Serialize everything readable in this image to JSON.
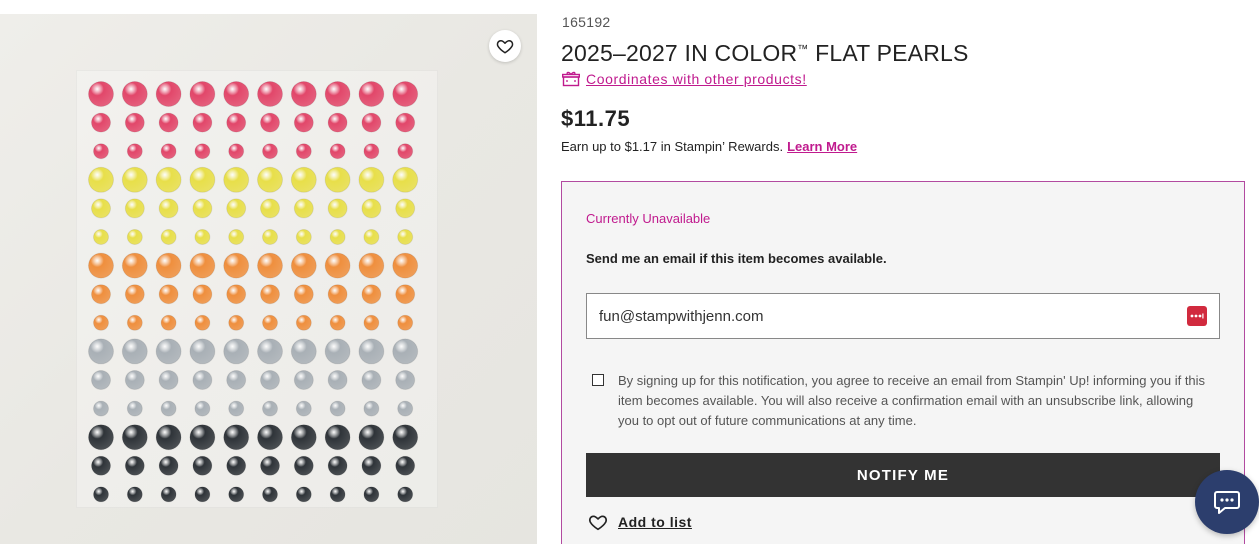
{
  "product": {
    "sku": "165192",
    "title": "2025–2027 IN COLOR",
    "title_tm": "™",
    "title_suffix": " FLAT PEARLS",
    "coordinates_link": "Coordinates with other products!",
    "price": "$11.75",
    "rewards_text": "Earn up to $1.17 in Stampin’ Rewards.",
    "rewards_link": "Learn More"
  },
  "image": {
    "favorite_icon": "heart-outline-icon",
    "pearl_rows": [
      {
        "color": "#e2476a",
        "size": "large"
      },
      {
        "color": "#e2476a",
        "size": "medium"
      },
      {
        "color": "#e2476a",
        "size": "small"
      },
      {
        "color": "#e8df4a",
        "size": "large"
      },
      {
        "color": "#e8df4a",
        "size": "medium"
      },
      {
        "color": "#e8df4a",
        "size": "small"
      },
      {
        "color": "#ef8f3e",
        "size": "large"
      },
      {
        "color": "#ef8f3e",
        "size": "medium"
      },
      {
        "color": "#ef8f3e",
        "size": "small"
      },
      {
        "color": "#a9b0b6",
        "size": "large"
      },
      {
        "color": "#a9b0b6",
        "size": "medium"
      },
      {
        "color": "#a9b0b6",
        "size": "small"
      },
      {
        "color": "#2f3439",
        "size": "large"
      },
      {
        "color": "#2f3439",
        "size": "medium"
      },
      {
        "color": "#2f3439",
        "size": "small"
      }
    ],
    "pearls_per_row": 10
  },
  "notify": {
    "status": "Currently Unavailable",
    "prompt": "Send me an email if this item becomes available.",
    "email_value": "fun@stampwithjenn.com",
    "password_manager_icon": "password-manager-icon",
    "consent_text": "By signing up for this notification, you agree to receive an email from Stampin' Up! informing you if this item becomes available. You will also receive a confirmation email with an unsubscribe link, allowing you to opt out of future communications at any time.",
    "consent_checked": false,
    "button_label": "NOTIFY ME",
    "add_to_list": "Add to list"
  },
  "colors": {
    "accent": "#c01a8e",
    "button": "#333333",
    "chat": "#2c3e6d"
  },
  "chat_icon": "chat-bubble-icon"
}
